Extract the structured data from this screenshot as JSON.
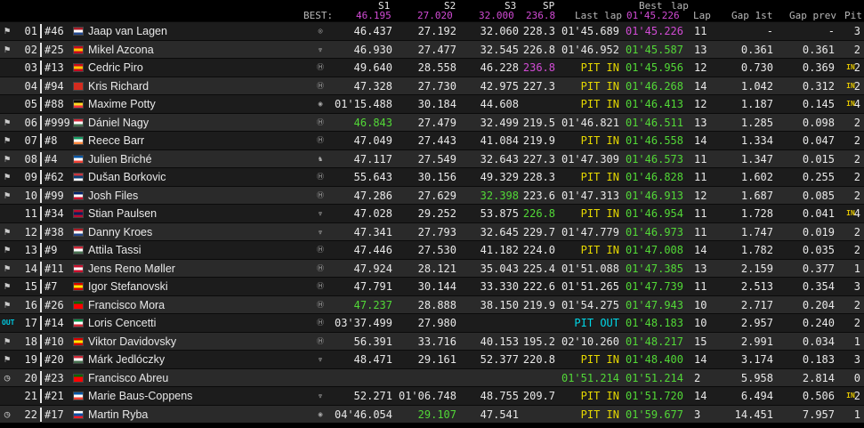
{
  "headers": {
    "best_label": "BEST:",
    "s1": "S1",
    "s2": "S2",
    "s3": "S3",
    "sp": "SP",
    "last_lap": "Last lap",
    "best_lap_top": "Best",
    "best_lap_bottom": "lap",
    "lap": "Lap",
    "gap_1st": "Gap 1st",
    "gap_prev": "Gap prev",
    "pit": "Pit"
  },
  "best": {
    "s1": "46.195",
    "s2": "27.020",
    "s3": "32.000",
    "sp": "236.8",
    "best_lap": "01'45.226"
  },
  "colors": {
    "purple": "#d14bd4",
    "green": "#52d837",
    "yellow": "#e6d800",
    "cyan": "#00d8e8"
  },
  "rows": [
    {
      "status": "flag",
      "pos": "01",
      "num": "#46",
      "flag": [
        "#ae1c28",
        "#ffffff",
        "#21468b"
      ],
      "name": "Jaap van Lagen",
      "brand": "audi-icon",
      "s1": "46.437",
      "s2": "27.192",
      "s3": "32.060",
      "sp": "228.3",
      "last": "01'45.689",
      "last_c": "",
      "best": "01'45.226",
      "best_c": "purple",
      "lap": "11",
      "gap1": "-",
      "gapp": "-",
      "pit": "3"
    },
    {
      "status": "flag",
      "pos": "02",
      "num": "#25",
      "flag": [
        "#c60b1e",
        "#ffc400",
        "#c60b1e"
      ],
      "name": "Mikel Azcona",
      "brand": "cupra-icon",
      "s1": "46.930",
      "s2": "27.477",
      "s3": "32.545",
      "sp": "226.8",
      "last": "01'46.952",
      "last_c": "",
      "best": "01'45.587",
      "best_c": "green",
      "lap": "13",
      "gap1": "0.361",
      "gapp": "0.361",
      "pit": "2"
    },
    {
      "status": "in",
      "pos": "03",
      "num": "#13",
      "flag": [
        "#c60b1e",
        "#ffc400",
        "#c60b1e"
      ],
      "name": "Cedric Piro",
      "brand": "honda-icon",
      "s1": "49.640",
      "s2": "28.558",
      "s3": "46.228",
      "sp": "236.8",
      "sp_c": "purple",
      "last": "PIT IN",
      "last_c": "yellow",
      "best": "01'45.956",
      "best_c": "green",
      "lap": "12",
      "gap1": "0.730",
      "gapp": "0.369",
      "pit": "2"
    },
    {
      "status": "in",
      "pos": "04",
      "num": "#94",
      "flag": [
        "#d52b1e",
        "#d52b1e",
        "#d52b1e"
      ],
      "name": "Kris Richard",
      "brand": "hyundai-icon",
      "s1": "47.328",
      "s2": "27.730",
      "s3": "42.975",
      "sp": "227.3",
      "last": "PIT IN",
      "last_c": "yellow",
      "best": "01'46.268",
      "best_c": "green",
      "lap": "14",
      "gap1": "1.042",
      "gapp": "0.312",
      "pit": "2"
    },
    {
      "status": "in",
      "pos": "05",
      "num": "#88",
      "flag": [
        "#000000",
        "#fdda24",
        "#ef3340"
      ],
      "name": "Maxime Potty",
      "brand": "vw-icon",
      "s1": "01'15.488",
      "s2": "30.184",
      "s3": "44.608",
      "sp": "",
      "last": "PIT IN",
      "last_c": "yellow",
      "best": "01'46.413",
      "best_c": "green",
      "lap": "12",
      "gap1": "1.187",
      "gapp": "0.145",
      "pit": "4"
    },
    {
      "status": "flag",
      "pos": "06",
      "num": "#999",
      "flag": [
        "#ce2939",
        "#ffffff",
        "#477050"
      ],
      "name": "Dániel Nagy",
      "brand": "hyundai-icon",
      "s1": "46.843",
      "s1_c": "green",
      "s2": "27.479",
      "s3": "32.499",
      "sp": "219.5",
      "last": "01'46.821",
      "last_c": "",
      "best": "01'46.511",
      "best_c": "green",
      "lap": "13",
      "gap1": "1.285",
      "gapp": "0.098",
      "pit": "2"
    },
    {
      "status": "flag",
      "pos": "07",
      "num": "#8",
      "flag": [
        "#169b62",
        "#ffffff",
        "#ff883e"
      ],
      "name": "Reece Barr",
      "brand": "hyundai-icon",
      "s1": "47.049",
      "s2": "27.443",
      "s3": "41.084",
      "sp": "219.9",
      "last": "PIT IN",
      "last_c": "yellow",
      "best": "01'46.558",
      "best_c": "green",
      "lap": "14",
      "gap1": "1.334",
      "gapp": "0.047",
      "pit": "2"
    },
    {
      "status": "flag",
      "pos": "08",
      "num": "#4",
      "flag": [
        "#0055a4",
        "#ffffff",
        "#ef4135"
      ],
      "name": "Julien Briché",
      "brand": "peugeot-icon",
      "s1": "47.117",
      "s2": "27.549",
      "s3": "32.643",
      "sp": "227.3",
      "last": "01'47.309",
      "last_c": "",
      "best": "01'46.573",
      "best_c": "green",
      "lap": "11",
      "gap1": "1.347",
      "gapp": "0.015",
      "pit": "2"
    },
    {
      "status": "flag",
      "pos": "09",
      "num": "#62",
      "flag": [
        "#c6363c",
        "#0c4076",
        "#ffffff"
      ],
      "name": "Dušan Borkovic",
      "brand": "hyundai-icon",
      "s1": "55.643",
      "s2": "30.156",
      "s3": "49.329",
      "sp": "228.3",
      "last": "PIT IN",
      "last_c": "yellow",
      "best": "01'46.828",
      "best_c": "green",
      "lap": "11",
      "gap1": "1.602",
      "gapp": "0.255",
      "pit": "2"
    },
    {
      "status": "flag",
      "pos": "10",
      "num": "#99",
      "flag": [
        "#012169",
        "#ffffff",
        "#c8102e"
      ],
      "name": "Josh Files",
      "brand": "honda-icon",
      "s1": "47.286",
      "s2": "27.629",
      "s3": "32.398",
      "s3_c": "green",
      "sp": "223.6",
      "last": "01'47.313",
      "last_c": "",
      "best": "01'46.913",
      "best_c": "green",
      "lap": "12",
      "gap1": "1.687",
      "gapp": "0.085",
      "pit": "2"
    },
    {
      "status": "in",
      "pos": "11",
      "num": "#34",
      "flag": [
        "#ba0c2f",
        "#00205b",
        "#ba0c2f"
      ],
      "name": "Stian Paulsen",
      "brand": "cupra-icon",
      "s1": "47.028",
      "s2": "29.252",
      "s3": "53.875",
      "sp": "226.8",
      "sp_c": "green",
      "last": "PIT IN",
      "last_c": "yellow",
      "best": "01'46.954",
      "best_c": "green",
      "lap": "11",
      "gap1": "1.728",
      "gapp": "0.041",
      "pit": "4"
    },
    {
      "status": "flag",
      "pos": "12",
      "num": "#38",
      "flag": [
        "#ae1c28",
        "#ffffff",
        "#21468b"
      ],
      "name": "Danny Kroes",
      "brand": "cupra-icon",
      "s1": "47.341",
      "s2": "27.793",
      "s3": "32.645",
      "sp": "229.7",
      "last": "01'47.779",
      "last_c": "",
      "best": "01'46.973",
      "best_c": "green",
      "lap": "11",
      "gap1": "1.747",
      "gapp": "0.019",
      "pit": "2"
    },
    {
      "status": "flag",
      "pos": "13",
      "num": "#9",
      "flag": [
        "#ce2939",
        "#ffffff",
        "#477050"
      ],
      "name": "Attila Tassi",
      "brand": "honda-icon",
      "s1": "47.446",
      "s2": "27.530",
      "s3": "41.182",
      "sp": "224.0",
      "last": "PIT IN",
      "last_c": "yellow",
      "best": "01'47.008",
      "best_c": "green",
      "lap": "14",
      "gap1": "1.782",
      "gapp": "0.035",
      "pit": "2"
    },
    {
      "status": "flag",
      "pos": "14",
      "num": "#11",
      "flag": [
        "#c8102e",
        "#ffffff",
        "#c8102e"
      ],
      "name": "Jens Reno Møller",
      "brand": "honda-icon",
      "s1": "47.924",
      "s2": "28.121",
      "s3": "35.043",
      "sp": "225.4",
      "last": "01'51.088",
      "last_c": "",
      "best": "01'47.385",
      "best_c": "green",
      "lap": "13",
      "gap1": "2.159",
      "gapp": "0.377",
      "pit": "1"
    },
    {
      "status": "flag",
      "pos": "15",
      "num": "#7",
      "flag": [
        "#d20000",
        "#ffe600",
        "#d20000"
      ],
      "name": "Igor Stefanovski",
      "brand": "honda-icon",
      "s1": "47.791",
      "s2": "30.144",
      "s3": "33.330",
      "sp": "222.6",
      "last": "01'51.265",
      "last_c": "",
      "best": "01'47.739",
      "best_c": "green",
      "lap": "11",
      "gap1": "2.513",
      "gapp": "0.354",
      "pit": "3"
    },
    {
      "status": "flag",
      "pos": "16",
      "num": "#26",
      "flag": [
        "#006600",
        "#ff0000",
        "#ff0000"
      ],
      "name": "Francisco Mora",
      "brand": "honda-icon",
      "s1": "47.237",
      "s1_c": "green",
      "s2": "28.888",
      "s3": "38.150",
      "sp": "219.9",
      "last": "01'54.275",
      "last_c": "",
      "best": "01'47.943",
      "best_c": "green",
      "lap": "10",
      "gap1": "2.717",
      "gapp": "0.204",
      "pit": "2"
    },
    {
      "status": "out",
      "pos": "17",
      "num": "#14",
      "flag": [
        "#009246",
        "#ffffff",
        "#ce2b37"
      ],
      "name": "Loris Cencetti",
      "brand": "hyundai-icon",
      "s1": "03'37.499",
      "s2": "27.980",
      "s3": "",
      "sp": "",
      "last": "PIT OUT",
      "last_c": "cyan",
      "best": "01'48.183",
      "best_c": "green",
      "lap": "10",
      "gap1": "2.957",
      "gapp": "0.240",
      "pit": "2"
    },
    {
      "status": "flag",
      "pos": "18",
      "num": "#10",
      "flag": [
        "#d20000",
        "#ffe600",
        "#d20000"
      ],
      "name": "Viktor Davidovsky",
      "brand": "honda-icon",
      "s1": "56.391",
      "s2": "33.716",
      "s3": "40.153",
      "sp": "195.2",
      "last": "02'10.260",
      "last_c": "",
      "best": "01'48.217",
      "best_c": "green",
      "lap": "15",
      "gap1": "2.991",
      "gapp": "0.034",
      "pit": "1"
    },
    {
      "status": "flag",
      "pos": "19",
      "num": "#20",
      "flag": [
        "#ce2939",
        "#ffffff",
        "#477050"
      ],
      "name": "Márk Jedlóczky",
      "brand": "cupra-icon",
      "s1": "48.471",
      "s2": "29.161",
      "s3": "52.377",
      "sp": "220.8",
      "last": "PIT IN",
      "last_c": "yellow",
      "best": "01'48.400",
      "best_c": "green",
      "lap": "14",
      "gap1": "3.174",
      "gapp": "0.183",
      "pit": "3"
    },
    {
      "status": "clock",
      "pos": "20",
      "num": "#23",
      "flag": [
        "#006600",
        "#ff0000",
        "#ff0000"
      ],
      "name": "Francisco Abreu",
      "brand": "",
      "s1": "",
      "s2": "",
      "s3": "",
      "sp": "",
      "last": "01'51.214",
      "last_c": "green",
      "best": "01'51.214",
      "best_c": "green",
      "lap": "2",
      "gap1": "5.958",
      "gapp": "2.814",
      "pit": "0"
    },
    {
      "status": "in",
      "pos": "21",
      "num": "#21",
      "flag": [
        "#0055a4",
        "#ffffff",
        "#ef4135"
      ],
      "name": "Marie Baus-Coppens",
      "brand": "cupra-icon",
      "s1": "52.271",
      "s2": "01'06.748",
      "s3": "48.755",
      "sp": "209.7",
      "last": "PIT IN",
      "last_c": "yellow",
      "best": "01'51.720",
      "best_c": "green",
      "lap": "14",
      "gap1": "6.494",
      "gapp": "0.506",
      "pit": "2"
    },
    {
      "status": "clock",
      "pos": "22",
      "num": "#17",
      "flag": [
        "#ffffff",
        "#0b4ea2",
        "#ee1c25"
      ],
      "name": "Martin Ryba",
      "brand": "vw-icon",
      "s1": "04'46.054",
      "s2": "29.107",
      "s2_c": "green",
      "s3": "47.541",
      "sp": "",
      "last": "PIT IN",
      "last_c": "yellow",
      "best": "01'59.677",
      "best_c": "green",
      "lap": "3",
      "gap1": "14.451",
      "gapp": "7.957",
      "pit": "1"
    }
  ]
}
